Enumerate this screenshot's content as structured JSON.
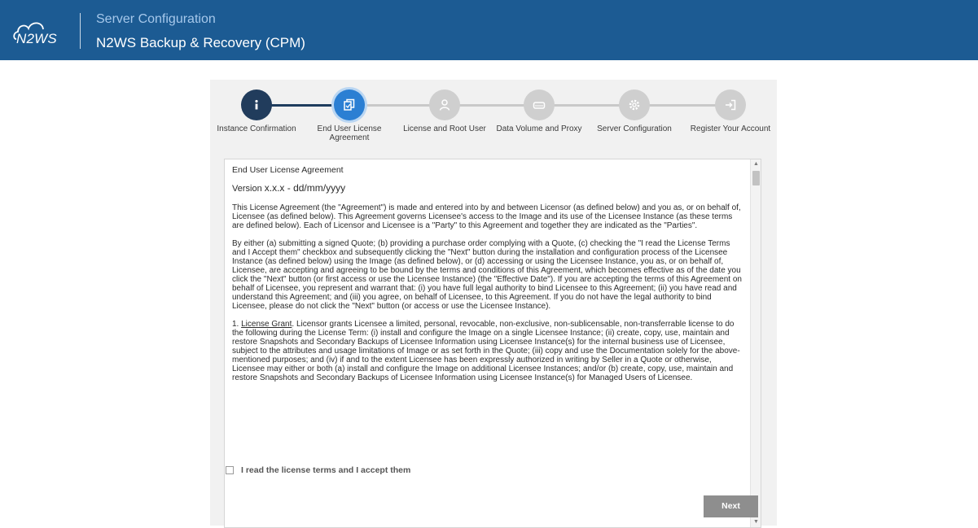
{
  "header": {
    "logo_text": "N2WS",
    "section": "Server Configuration",
    "title": "N2WS Backup & Recovery (CPM)"
  },
  "steps": [
    {
      "label": "Instance Confirmation",
      "status": "done",
      "icon": "info-icon"
    },
    {
      "label": "End User License Agreement",
      "status": "active",
      "icon": "document-copy-icon"
    },
    {
      "label": "License and Root User",
      "status": "pending",
      "icon": "user-icon"
    },
    {
      "label": "Data Volume and Proxy",
      "status": "pending",
      "icon": "drive-icon"
    },
    {
      "label": "Server Configuration",
      "status": "pending",
      "icon": "gear-icon"
    },
    {
      "label": "Register Your Account",
      "status": "pending",
      "icon": "sign-in-icon"
    }
  ],
  "eula": {
    "heading": "End User License Agreement",
    "version_prefix": "Version ",
    "version_value": "x.x.x - dd/mm/yyyy",
    "para1": "This License Agreement (the \"Agreement\") is made and entered into by and between Licensor (as defined below) and you as, or on behalf of, Licensee (as defined below). This Agreement governs Licensee's access to the Image and its use of the Licensee Instance (as these terms are defined below). Each of Licensor and Licensee is a \"Party\" to this Agreement and together they are indicated as the \"Parties\".",
    "para2": "By either (a) submitting a signed Quote; (b) providing a purchase order complying with a Quote, (c) checking the \"I read the License Terms and I Accept them\" checkbox and subsequently clicking the \"Next\" button during the installation and configuration process of the Licensee Instance (as defined below) using the Image (as defined below), or (d) accessing or using the Licensee Instance, you as, or on behalf of, Licensee, are accepting and agreeing to be bound by the terms and conditions of this Agreement, which becomes effective as of the date you click the \"Next\" button (or first access or use the Licensee Instance) (the \"Effective Date\"). If you are accepting the terms of this Agreement on behalf of Licensee, you represent and warrant that: (i) you have full legal authority to bind Licensee to this Agreement; (ii) you have read and understand this Agreement; and (iii) you agree, on behalf of Licensee, to this Agreement. If you do not have the legal authority to bind Licensee, please do not click the \"Next\" button (or access or use the Licensee Instance).",
    "para3_prefix": "1. ",
    "para3_term": "License Grant",
    "para3_body": ". Licensor grants Licensee a limited, personal, revocable, non-exclusive, non-sublicensable, non-transferrable license to do the following during the License Term: (i) install and configure the Image on a single Licensee Instance; (ii) create, copy, use, maintain and restore Snapshots and Secondary Backups of Licensee Information using Licensee Instance(s) for the internal business use of Licensee, subject to the attributes and usage limitations of Image or as set forth in the Quote; (iii) copy and use the Documentation solely for the above-mentioned purposes; and (iv) if and to the extent Licensee has been expressly authorized in writing by Seller in a Quote or otherwise, Licensee may either or both (a) install and configure the Image on additional Licensee Instances; and/or (b) create, copy, use, maintain and restore Snapshots and Secondary Backups of Licensee Information using Licensee Instance(s) for Managed Users of Licensee."
  },
  "accept": {
    "label": "I read the license terms and I accept them",
    "checked": false
  },
  "next_button": "Next",
  "colors": {
    "header_bg": "#1c5b93",
    "step_done": "#213c5c",
    "step_active": "#2b7fd3",
    "step_pending": "#cfcfcf",
    "button_disabled": "#8e8e8e"
  }
}
